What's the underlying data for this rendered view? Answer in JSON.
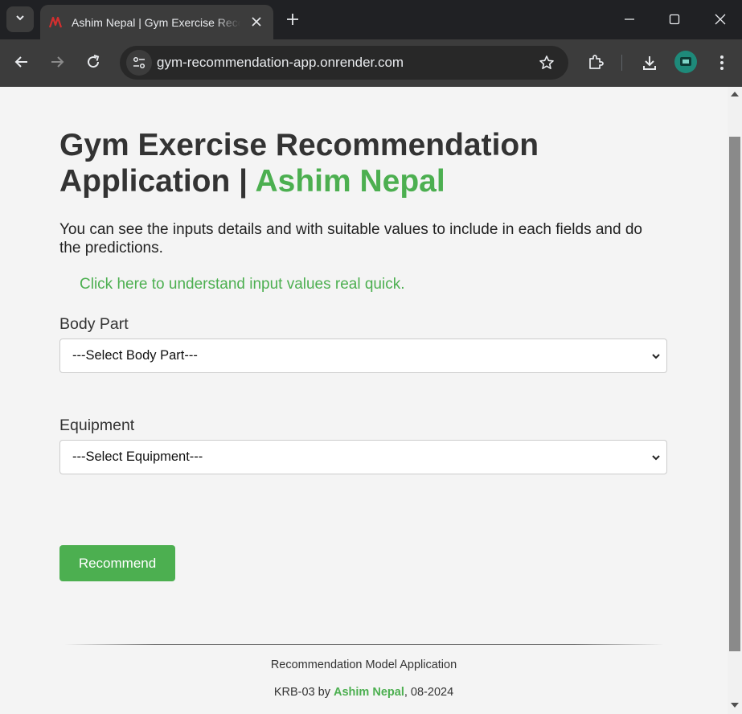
{
  "browser": {
    "tab_title": "Ashim Nepal | Gym Exercise Recommendation Application",
    "url": "gym-recommendation-app.onrender.com"
  },
  "page": {
    "title_main": "Gym Exercise Recommendation Application |",
    "title_author": "Ashim Nepal",
    "intro": "You can see the inputs details and with suitable values to include in each fields and do the predictions.",
    "help_link": "Click here to understand input values real quick.",
    "body_part": {
      "label": "Body Part",
      "selected": "---Select Body Part---"
    },
    "equipment": {
      "label": "Equipment",
      "selected": "---Select Equipment---"
    },
    "recommend_button": "Recommend",
    "footer": {
      "line1": "Recommendation Model Application",
      "line2_prefix": "KRB-03 by",
      "author": "Ashim Nepal",
      "line2_suffix": ", 08-2024"
    }
  },
  "colors": {
    "accent": "#4caf50",
    "chrome_dark": "#202124",
    "chrome_toolbar": "#3c3c3c",
    "page_bg": "#f4f4f4"
  },
  "icons": [
    "tab-search-icon",
    "favicon-icon",
    "close-icon",
    "plus-icon",
    "minimize-icon",
    "maximize-icon",
    "window-close-icon",
    "back-icon",
    "forward-icon",
    "reload-icon",
    "site-info-icon",
    "star-icon",
    "extensions-icon",
    "download-icon",
    "profile-avatar-icon",
    "more-icon",
    "chevron-down-icon"
  ]
}
